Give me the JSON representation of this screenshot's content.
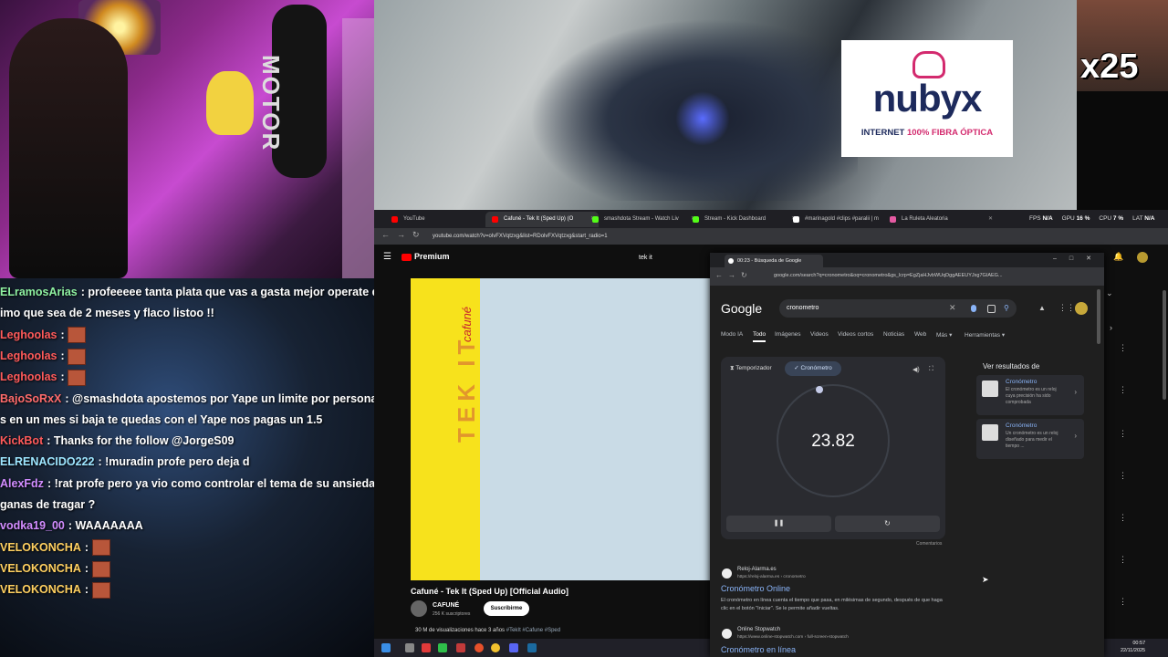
{
  "stream": {
    "webcam": {
      "bag_text": "MOTOR"
    },
    "sponsor": {
      "brand": "nubyx",
      "tagline_prefix": "INTERNET ",
      "tagline_highlight": "100% FIBRA ÓPTICA",
      "brand_color": "#1d2a5c",
      "accent_color": "#d32a6e"
    },
    "facecam": {
      "overlay_text": "x25"
    },
    "chat": [
      {
        "user": "ELramosArias",
        "color": "#8ef0a0",
        "text": ": profeeeee tanta plata que vas a gasta mejor operate de a"
      },
      {
        "user": "",
        "color": "#ffffff",
        "text": "imo que sea de 2 meses y flaco listoo !!"
      },
      {
        "user": "Leghoolas",
        "color": "#ff5a5a",
        "text": ":",
        "emote": true
      },
      {
        "user": "Leghoolas",
        "color": "#ff5a5a",
        "text": ":",
        "emote": true
      },
      {
        "user": "Leghoolas",
        "color": "#ff5a5a",
        "text": ":",
        "emote": true
      },
      {
        "user": "BajoSoRxX",
        "color": "#ff6b6b",
        "text": ": @smashdota apostemos por Yape un limite por persona baj"
      },
      {
        "user": "",
        "color": "#ffffff",
        "text": "s en un mes si baja te quedas con el Yape nos pagas un 1.5"
      },
      {
        "user": "KickBot",
        "color": "#ff5a5a",
        "text": ": Thanks for the follow @JorgeS09"
      },
      {
        "user": "ELRENACIDO222",
        "color": "#9ee6ff",
        "text": ": !muradin profe pero deja d"
      },
      {
        "user": "AlexFdz",
        "color": "#d28cff",
        "text": ": !rat profe pero ya vio como controlar el tema de su ansiedad y c"
      },
      {
        "user": "",
        "color": "#ffffff",
        "text": "ganas de tragar ?"
      },
      {
        "user": "vodka19_00",
        "color": "#d28cff",
        "text": ": WAAAAAAA"
      },
      {
        "user": "VELOKONCHA",
        "color": "#ffd060",
        "text": ":",
        "emote": true
      },
      {
        "user": "VELOKONCHA",
        "color": "#ffd060",
        "text": ":",
        "emote": true
      },
      {
        "user": "VELOKONCHA",
        "color": "#ffd060",
        "text": ":",
        "emote": true
      }
    ]
  },
  "browser": {
    "tabs": [
      {
        "label": "YouTube",
        "fav": "#ff0000"
      },
      {
        "label": "Cafuné - Tek It (Sped Up) (O",
        "fav": "#ff0000",
        "active": true
      },
      {
        "label": "smashdota Stream - Watch Liv",
        "fav": "#53fc18"
      },
      {
        "label": "Stream - Kick Dashboard",
        "fav": "#53fc18"
      },
      {
        "label": "#marinagold #clips #paralii | m",
        "fav": "#ffffff"
      },
      {
        "label": "La Ruleta Aleatoria",
        "fav": "#e55aa2"
      }
    ],
    "stats": [
      {
        "label": "FPS",
        "value": "N/A"
      },
      {
        "label": "GPU",
        "value": "16 %"
      },
      {
        "label": "CPU",
        "value": "7 %"
      },
      {
        "label": "LAT",
        "value": "N/A"
      }
    ],
    "url": "youtube.com/watch?v=olvFXVqtzxg&list=RDolvFXVqtzxg&start_radio=1",
    "youtube": {
      "logo": "Premium",
      "search_value": "tek it",
      "cover_sig": "cafuné",
      "cover_text": "TEK IT",
      "video_title": "Cafuné - Tek It (Sped Up) [Official Audio]",
      "channel": "CAFUNÉ",
      "subscribers": "256 K suscriptores",
      "subscribe_label": "Suscribirme",
      "views": "30 M de visualizaciones  hace 3 años",
      "hashtags": "#TekIt #Cafune #Sped"
    }
  },
  "google": {
    "tab_title": "00:23 - Búsqueda de Google",
    "url": "google.com/search?q=cronometro&oq=cronometro&gs_lcrp=EgZjaHJvbWUqDggAEEUYJxg7GIAEG...",
    "logo": "Google",
    "query": "cronometro",
    "filters": [
      "Modo IA",
      "Todo",
      "Imágenes",
      "Videos",
      "Videos cortos",
      "Noticias",
      "Web",
      "Más ▾",
      "Herramientas ▾"
    ],
    "stopwatch": {
      "timer_label": "Temporizador",
      "stopwatch_label": "✓ Cronómetro",
      "time": "23.82",
      "pause": "❚❚",
      "reset": "↻",
      "comments": "Comentarios"
    },
    "side": {
      "title": "Ver resultados de",
      "cards": [
        {
          "title": "Cronómetro",
          "desc": "El cronómetro es un reloj cuya precisión ha sido comprobada"
        },
        {
          "title": "Cronómetro",
          "desc": "Un cronómetro es un reloj diseñado para medir el tiempo ..."
        }
      ]
    },
    "results": [
      {
        "site": "Reloj-Alarma.es",
        "url": "https://reloj-alarma.es › cronometro",
        "title": "Cronómetro Online",
        "snippet": "El cronómetro en línea cuenta el tiempo que pasa, en milésimas de segundo, después de que haga clic en el botón \"Iniciar\". Se le permite añadir vueltas."
      },
      {
        "site": "Online Stopwatch",
        "url": "https://www.online-stopwatch.com › full-screen-stopwatch",
        "title": "Cronómetro en línea",
        "snippet": ""
      }
    ]
  },
  "taskbar": {
    "time": "00:57",
    "date": "22/11/2025"
  }
}
